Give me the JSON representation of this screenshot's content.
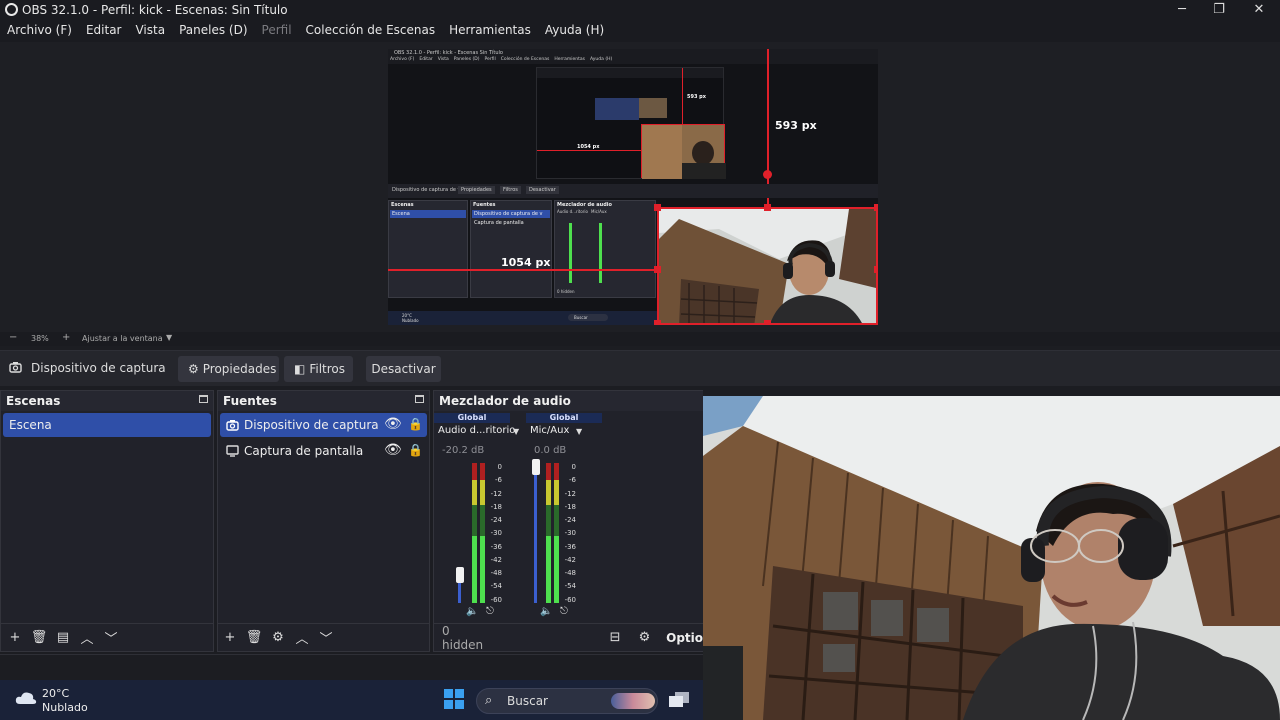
{
  "window": {
    "title": "OBS 32.1.0 - Perfil: kick - Escenas: Sin Título",
    "controls": {
      "minimize": "─",
      "maximize": "❐",
      "close": "✕"
    }
  },
  "menu": [
    {
      "label": "Archivo (F)",
      "disabled": false
    },
    {
      "label": "Editar",
      "disabled": false
    },
    {
      "label": "Vista",
      "disabled": false
    },
    {
      "label": "Paneles (D)",
      "disabled": false
    },
    {
      "label": "Perfil",
      "disabled": true
    },
    {
      "label": "Colección de Escenas",
      "disabled": false
    },
    {
      "label": "Herramientas",
      "disabled": false
    },
    {
      "label": "Ayuda (H)",
      "disabled": false
    }
  ],
  "preview": {
    "measure_height": "593 px",
    "measure_width": "1054 px",
    "zoom": "38%",
    "zoom_minus": "−",
    "zoom_plus": "+",
    "zoom_mode": "Ajustar a la ventana"
  },
  "mini": {
    "title": "OBS 32.1.0 - Perfil: kick - Escenas Sin Título",
    "menu": [
      "Archivo (F)",
      "Editar",
      "Vista",
      "Paneles (D)",
      "Perfil",
      "Colección de Escenas",
      "Herramientas",
      "Ayuda (H)"
    ],
    "measure_a": "593 px",
    "measure_b": "1054 px",
    "toolbar": [
      "Dispositivo de captura de v",
      "Propiedades",
      "Filtros",
      "Desactivar"
    ],
    "docks": [
      "Escenas",
      "Fuentes",
      "Mezclador de audio"
    ],
    "scene": "Escena",
    "sources": [
      "Dispositivo de captura de v",
      "Captura de pantalla"
    ],
    "ch1": "Audio d...ritorio",
    "ch2": "Mic/Aux",
    "global": "Global",
    "hidden": "0 hidden",
    "options": "Optio",
    "temp": "20°C",
    "weather": "Nublado",
    "search": "Buscar"
  },
  "source_toolbar": {
    "source_name": "Dispositivo de captura de v",
    "properties": "Propiedades",
    "filters": "Filtros",
    "deactivate": "Desactivar"
  },
  "scenes": {
    "title": "Escenas",
    "items": [
      {
        "label": "Escena",
        "selected": true
      }
    ],
    "footer": {
      "add": "+",
      "remove": "🗑",
      "filter": "▤",
      "up": "︿",
      "down": "﹀"
    }
  },
  "sources": {
    "title": "Fuentes",
    "items": [
      {
        "label": "Dispositivo de captura de v",
        "icon": "camera-icon",
        "selected": true
      },
      {
        "label": "Captura de pantalla",
        "icon": "monitor-icon",
        "selected": false
      }
    ],
    "footer": {
      "add": "+",
      "remove": "🗑",
      "settings": "⚙",
      "up": "︿",
      "down": "﹀"
    }
  },
  "mixer": {
    "title": "Mezclador de audio",
    "channels": [
      {
        "tag": "Global",
        "name": "Audio d...ritorio",
        "db": "-20.2 dB",
        "level": 0.23
      },
      {
        "tag": "Global",
        "name": "Mic/Aux",
        "db": "0.0 dB",
        "level": 1.0
      }
    ],
    "scale": [
      "0",
      "-6",
      "-12",
      "-18",
      "-24",
      "-30",
      "-36",
      "-42",
      "-48",
      "-54",
      "-60"
    ],
    "hidden": "0 hidden",
    "options": "Optio"
  },
  "taskbar": {
    "temperature": "20°C",
    "weather": "Nublado",
    "search_placeholder": "Buscar"
  },
  "colors": {
    "accent": "#2f4fa8",
    "measure_red": "#e0202a",
    "fader_blue": "#3b5fcf",
    "meter_green": "#4ee04e",
    "meter_yellow": "#c8c830",
    "meter_red": "#b02020"
  }
}
